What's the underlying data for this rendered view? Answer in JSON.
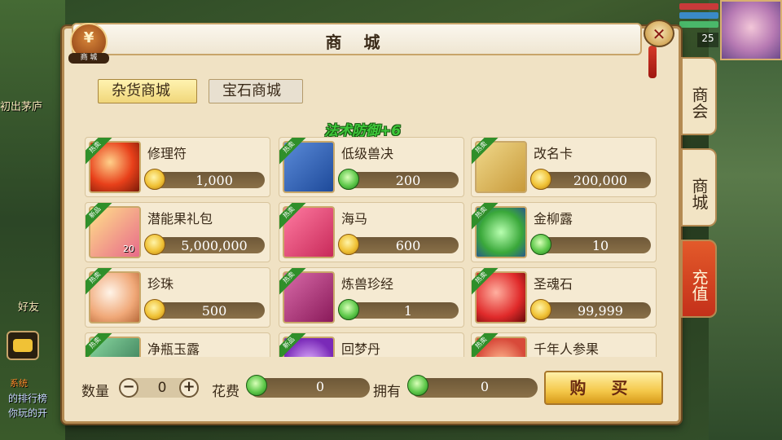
{
  "background": {
    "left_texts": [
      "初出茅庐",
      "好友"
    ],
    "left_bottom_lines": [
      "系统",
      "的排行榜",
      "你玩的开"
    ],
    "level": "25"
  },
  "header": {
    "title": "商 城",
    "badge_icon": "yen-bag-icon",
    "badge_label": "商 城",
    "close_icon": "close-icon"
  },
  "tabs": [
    {
      "label": "杂货商城",
      "active": true
    },
    {
      "label": "宝石商城",
      "active": false
    }
  ],
  "buff_text": "法术防御+6",
  "items": [
    {
      "name": "修理符",
      "price": "1,000",
      "currency": "gold",
      "tag": "热卖",
      "icon": "red-orb-icon"
    },
    {
      "name": "低级兽决",
      "price": "200",
      "currency": "jade",
      "tag": "热卖",
      "icon": "blue-book-icon"
    },
    {
      "name": "改名卡",
      "price": "200,000",
      "currency": "gold",
      "tag": "热卖",
      "icon": "scroll-icon"
    },
    {
      "name": "潜能果礼包",
      "price": "5,000,000",
      "currency": "gold",
      "tag": "新品",
      "icon": "gift-box-icon",
      "count": "20"
    },
    {
      "name": "海马",
      "price": "600",
      "currency": "gold",
      "tag": "热卖",
      "icon": "seahorse-icon"
    },
    {
      "name": "金柳露",
      "price": "10",
      "currency": "jade",
      "tag": "热卖",
      "icon": "green-potion-icon"
    },
    {
      "name": "珍珠",
      "price": "500",
      "currency": "gold",
      "tag": "热卖",
      "icon": "pearl-icon"
    },
    {
      "name": "炼兽珍经",
      "price": "1",
      "currency": "jade",
      "tag": "热卖",
      "icon": "red-book-icon"
    },
    {
      "name": "圣魂石",
      "price": "99,999",
      "currency": "gold",
      "tag": "热卖",
      "icon": "red-gem-icon"
    },
    {
      "name": "净瓶玉露",
      "price": "",
      "currency": "jade",
      "tag": "热卖",
      "icon": "vase-icon"
    },
    {
      "name": "回梦丹",
      "price": "",
      "currency": "jade",
      "tag": "新品",
      "icon": "purple-pill-icon"
    },
    {
      "name": "千年人参果",
      "price": "",
      "currency": "jade",
      "tag": "热卖",
      "icon": "ginseng-fruit-icon"
    }
  ],
  "bottom": {
    "qty_label": "数量",
    "qty_value": "0",
    "minus": "−",
    "plus": "+",
    "cost_label": "花费",
    "cost_value": "0",
    "own_label": "拥有",
    "own_value": "0",
    "buy_label": "购 买"
  },
  "side_tabs": [
    "商会",
    "商城",
    "充值"
  ],
  "colors": {
    "panel_bg": "#f0e2c4",
    "accent_gold": "#f4c84a",
    "tag_green": "#2f8f2a",
    "recharge_red": "#c4301a"
  }
}
